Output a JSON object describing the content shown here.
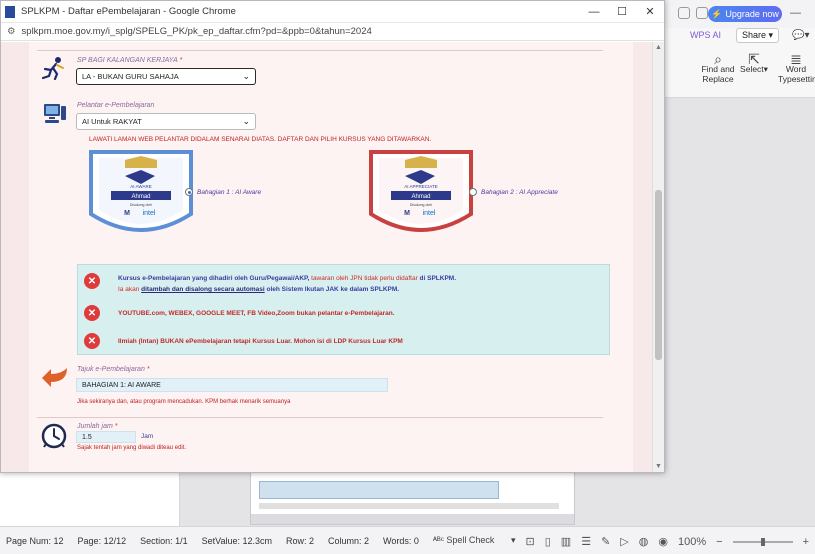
{
  "browser": {
    "title": "SPLKPM - Daftar ePembelajaran - Google Chrome",
    "url": "splkpm.moe.gov.my/i_splg/SPELG_PK/pk_ep_daftar.cfm?pd=&ppb=0&tahun=2024",
    "minimize": "—",
    "maximize": "☐",
    "close": "✕"
  },
  "form": {
    "pelajar_label": "SP BAGI KALANGAN KERJAYA",
    "pelajar_value": "LA - BUKAN GURU SAHAJA",
    "platform_label": "Pelantar e-Pembelajaran",
    "platform_value": "AI Untuk RAKYAT",
    "instruction": "LAWATI LAMAN WEB PELANTAR DIDALAM SENARAI DIATAS. DAFTAR DAN PILIH KURSUS YANG DITAWARKAN.",
    "badge1": {
      "tag": "AI AWARE",
      "name": "Ahmad",
      "sub": "Disokong oleh",
      "brand": "intel"
    },
    "badge2": {
      "tag": "AI APPRECIATE",
      "name": "Ahmad",
      "sub": "Disokong oleh",
      "brand": "intel"
    },
    "option1": "Bahagian 1 : AI Aware",
    "option2": "Bahagian 2 : AI Appreciate",
    "info1_a": "Kursus e-Pembelajaran yang dihadiri oleh Guru/Pegawai/AKP,",
    "info1_b": "tawaran oleh JPN tidak perlu didaftar",
    "info1_c": "di SPLKPM.",
    "info1_d": "Ia akan",
    "info1_e": "ditambah dan disalong secara automasi",
    "info1_f": "oleh Sistem Ikutan JAK ke dalam SPLKPM.",
    "info2": "YOUTUBE.com, WEBEX, GOOGLE MEET, FB Video,Zoom bukan pelantar e-Pembelajaran.",
    "info3": "Ilmiah (Intan) BUKAN ePembelajaran tetapi Kursus Luar. Mohon isi di LDP Kursus Luar KPM",
    "tajuk_label": "Tajuk e-Pembelajaran",
    "tajuk_value": "BAHAGIAN 1: AI AWARE",
    "tajuk_note": "Jika sekiranya dan, atau program mencadukan. KPM berhak menarik semuanya",
    "jam_label": "Jumlah jam",
    "jam_value": "1.5",
    "jam_unit": "Jam",
    "jam_note": "Sajak tentah jam yang diwadi diteau edit."
  },
  "wps": {
    "upgrade": "Upgrade now",
    "wps_ai": "WPS AI",
    "share": "Share",
    "find": "Find and Replace",
    "select": "Select",
    "word": "Word",
    "word_sub": "Typesetting"
  },
  "status": {
    "page_num": "Page Num: 12",
    "page": "Page: 12/12",
    "section": "Section: 1/1",
    "setvalue": "SetValue: 12.3cm",
    "row": "Row: 2",
    "column": "Column: 2",
    "words": "Words: 0",
    "spell": "Spell Check",
    "zoom": "100%"
  }
}
